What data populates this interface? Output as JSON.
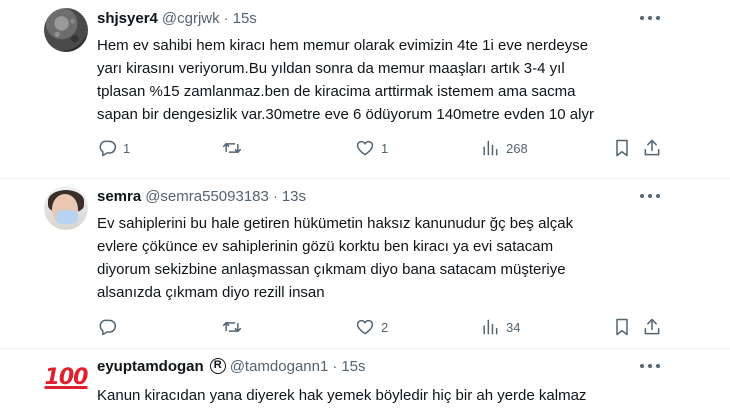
{
  "tweets": [
    {
      "display_name": "shjsyer4",
      "handle": "@cgrjwk",
      "separator": "·",
      "time": "15s",
      "text_lines": [
        "Hem ev sahibi hem kiracı hem memur olarak evimizin 4te 1i eve nerdeyse",
        "yarı kirasını veriyorum.Bu yıldan sonra da memur maaşları artık 3-4 yıl",
        "tplasan %15 zamlanmaz.ben de kiracima arttirmak istemem ama sacma",
        "sapan bir dengesizlik var.30metre eve 6 ödüyorum 140metre evden 10 alyr"
      ],
      "replies": "1",
      "retweets": "",
      "likes": "1",
      "views": "268"
    },
    {
      "display_name": "semra",
      "handle": "@semra55093183",
      "separator": "·",
      "time": "13s",
      "text_lines": [
        "Ev sahiplerini bu hale getiren hükümetin haksız kanunudur ğç beş alçak",
        "evlere çökünce ev sahiplerinin gözü korktu ben kiracı ya evi satacam",
        "diyorum sekizbine anlaşmassan çıkmam diyo bana satacam müşteriye",
        "alsanızda çıkmam diyo rezill insan"
      ],
      "replies": "",
      "retweets": "",
      "likes": "2",
      "views": "34"
    },
    {
      "display_name": "eyuptamdogan",
      "avatar_emoji": "100",
      "registered_mark": "R",
      "handle": "@tamdogann1",
      "separator": "·",
      "time": "15s",
      "text_lines": [
        "Kanun kiracıdan yana diyerek hak yemek böyledir hiç bir ah yerde kalmaz"
      ]
    }
  ],
  "icons": {
    "more": "more-horizontal-icon",
    "reply": "reply-icon",
    "retweet": "retweet-icon",
    "like": "heart-icon",
    "views": "views-chart-icon",
    "bookmark": "bookmark-icon",
    "share": "share-icon"
  },
  "colors": {
    "text_primary": "#0f1419",
    "text_secondary": "#536471",
    "divider": "#eff3f4",
    "emoji_red": "#e0202e"
  }
}
